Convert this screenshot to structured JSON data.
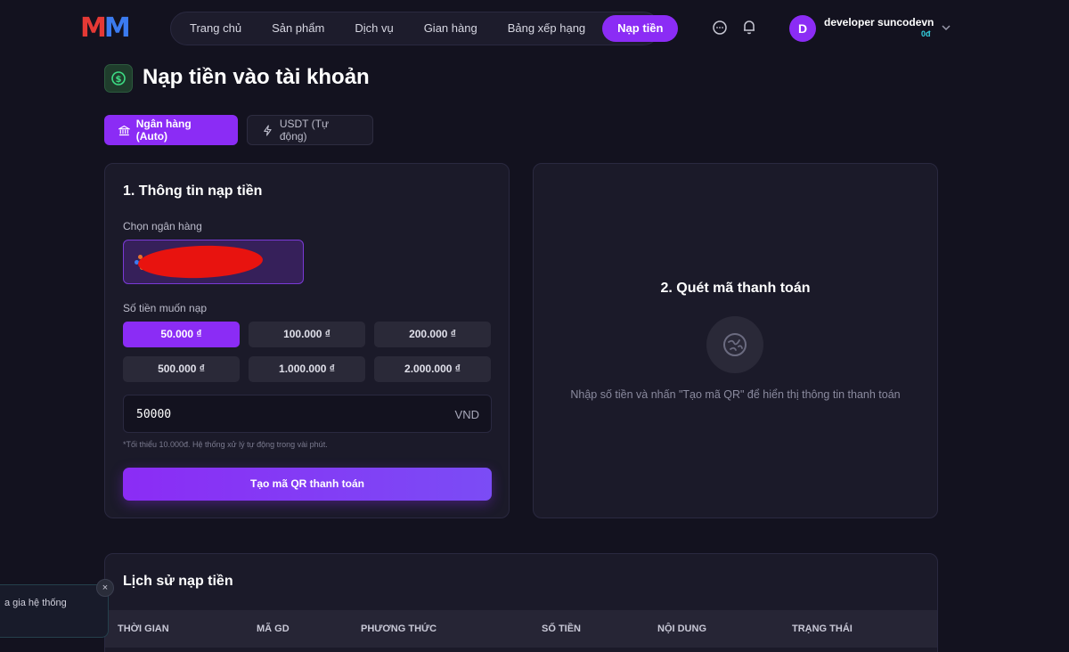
{
  "brand": {
    "logo_left": "M",
    "logo_right": "M"
  },
  "nav": {
    "items": [
      "Trang chủ",
      "Sản phẩm",
      "Dịch vụ",
      "Gian hàng",
      "Bảng xếp hạng"
    ],
    "active": "Nạp tiền"
  },
  "user": {
    "initial": "D",
    "name": "developer suncodevn",
    "balance": "0đ"
  },
  "page": {
    "title": "Nạp tiền vào tài khoản"
  },
  "tabs": {
    "bank": "Ngân hàng (Auto)",
    "usdt": "USDT (Tự động)"
  },
  "form": {
    "title": "1. Thông tin nạp tiền",
    "bank_label": "Chọn ngân hàng",
    "amount_label": "Số tiền muốn nạp",
    "presets": [
      "50.000 ₫",
      "100.000 ₫",
      "200.000 ₫",
      "500.000 ₫",
      "1.000.000 ₫",
      "2.000.000 ₫"
    ],
    "selected_preset": "50.000 ₫",
    "amount_value": "50000",
    "unit": "VND",
    "hint": "*Tối thiểu 10.000đ. Hệ thống xử lý tự động trong vài phút.",
    "submit": "Tạo mã QR thanh toán"
  },
  "qr": {
    "title": "2. Quét mã thanh toán",
    "hint": "Nhập số tiền và nhấn \"Tạo mã QR\" để hiển thị thông tin thanh toán"
  },
  "history": {
    "title": "Lịch sử nạp tiền",
    "columns": [
      "THỜI GIAN",
      "MÃ GD",
      "PHƯƠNG THỨC",
      "SỐ TIỀN",
      "NỘI DUNG",
      "TRẠNG THÁI"
    ]
  },
  "toast": {
    "text": "a gia hệ thống",
    "close": "×"
  },
  "colors": {
    "accent": "#8b2cf5",
    "background": "#13121f",
    "card": "#1b1a29",
    "balance": "#34d1e0"
  }
}
